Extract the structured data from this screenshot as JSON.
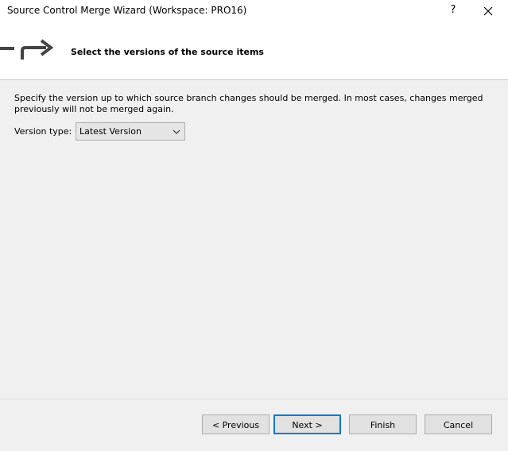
{
  "window": {
    "title": "Source Control Merge Wizard (Workspace: PRO16)",
    "help_label": "?",
    "close_label": "✕"
  },
  "header": {
    "title": "Select the versions of the source items",
    "icon": "merge-arrow-icon"
  },
  "body": {
    "description": "Specify the version up to which source branch changes should be merged.  In most cases, changes merged previously will not be merged again.",
    "version_type_label": "Version type:",
    "version_type_value": "Latest Version"
  },
  "buttons": {
    "previous": "< Previous",
    "next": "Next >",
    "finish": "Finish",
    "cancel": "Cancel"
  },
  "colors": {
    "default_button_border": "#0078d7",
    "window_bg": "#f0f0f0",
    "header_bg": "#ffffff"
  }
}
